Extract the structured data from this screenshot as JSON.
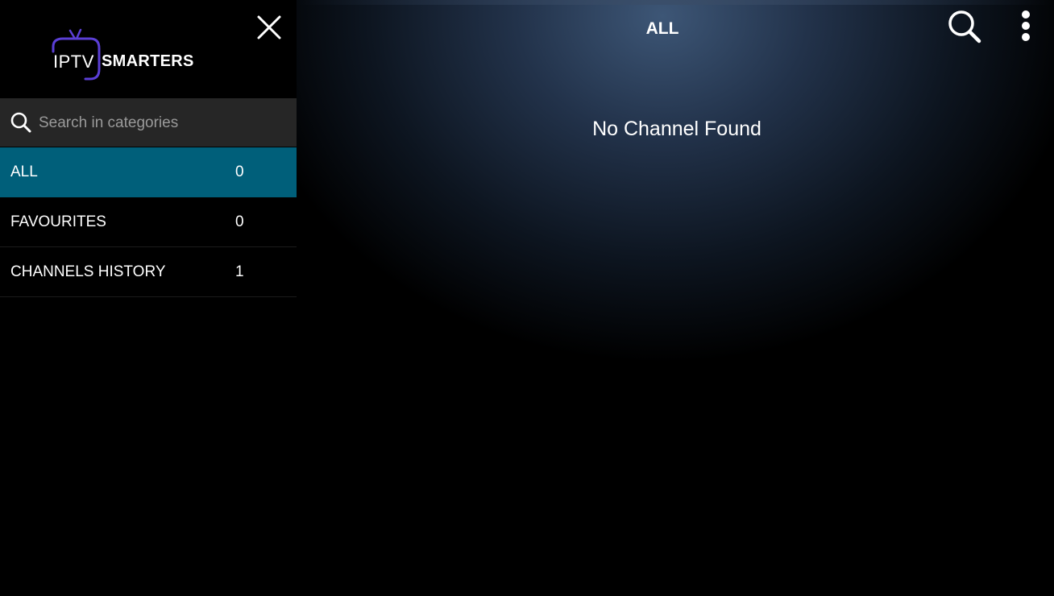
{
  "logo": {
    "text_iptv": "IPTV",
    "text_smarters": "SMARTERS"
  },
  "search": {
    "placeholder": "Search in categories"
  },
  "categories": [
    {
      "label": "ALL",
      "count": "0",
      "active": true
    },
    {
      "label": "FAVOURITES",
      "count": "0",
      "active": false
    },
    {
      "label": "CHANNELS HISTORY",
      "count": "1",
      "active": false
    }
  ],
  "header": {
    "title": "ALL"
  },
  "main": {
    "empty_message": "No Channel Found"
  },
  "icons": {
    "close": "close-icon",
    "search": "search-icon",
    "more": "more-vertical-icon",
    "logo": "tv-antenna-logo"
  },
  "colors": {
    "active_category": "#005f7a",
    "search_bg": "#262626",
    "logo_accent": "#5b3fd6"
  }
}
